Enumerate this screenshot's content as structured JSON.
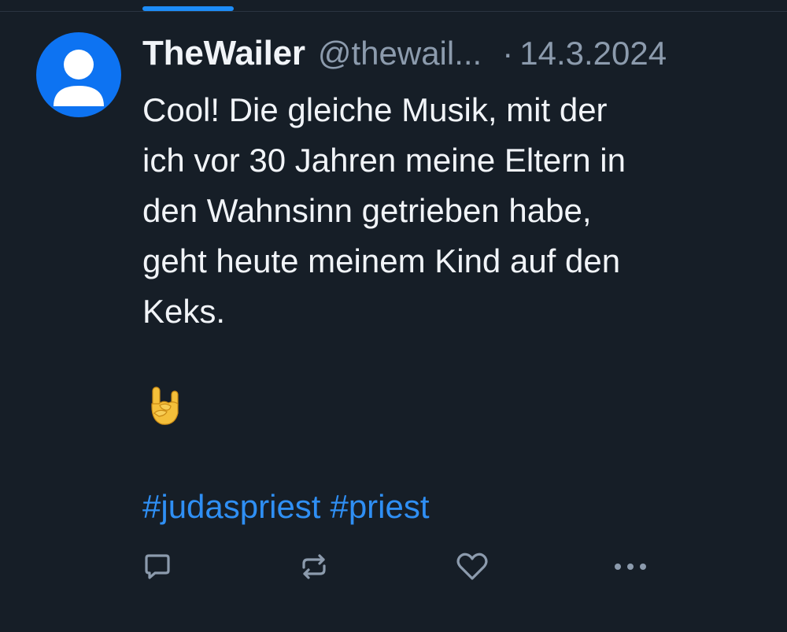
{
  "post": {
    "author": {
      "display_name": "TheWailer",
      "handle": "@thewail...",
      "avatar_icon": "default-user-avatar-icon"
    },
    "separator": "·",
    "date": "14.3.2024",
    "text_lines": [
      "Cool! Die gleiche Musik, mit der",
      "ich vor 30 Jahren meine Eltern in",
      "den Wahnsinn getrieben habe,",
      "geht heute meinem Kind auf den",
      "Keks."
    ],
    "emoji_icon": "sign-of-the-horns-emoji",
    "hashtags": [
      "#judaspriest",
      "#priest"
    ]
  },
  "actions": {
    "reply_icon": "reply-icon",
    "repost_icon": "repost-icon",
    "like_icon": "heart-icon",
    "more_icon": "more-icon"
  },
  "colors": {
    "background": "#161e27",
    "primary_text": "#f1f4f8",
    "secondary_text": "#8c9bad",
    "accent": "#1d8cf7",
    "hashtag": "#2f8ff4",
    "avatar": "#0d73f2"
  }
}
